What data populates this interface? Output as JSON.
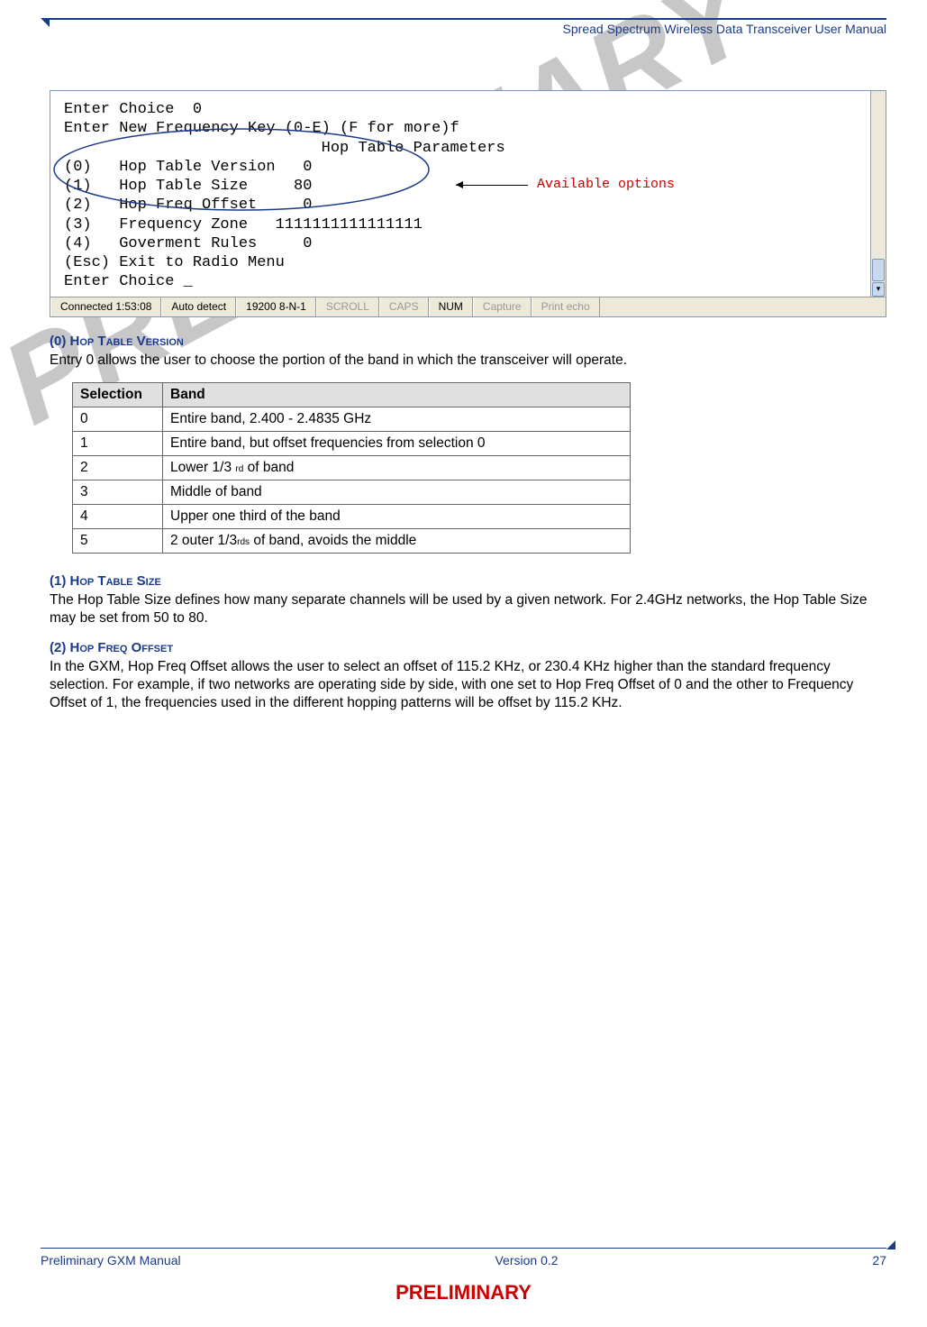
{
  "header": {
    "title": "Spread Spectrum Wireless Data Transceiver User Manual"
  },
  "terminal": {
    "lines": [
      "Enter Choice  0",
      "Enter New Frequency Key (0-E) (F for more)f",
      "                            Hop Table Parameters",
      "(0)   Hop Table Version   0",
      "(1)   Hop Table Size     80",
      "(2)   Hop Freq Offset     0",
      "(3)   Frequency Zone   1111111111111111",
      "(4)   Goverment Rules     0",
      "(Esc) Exit to Radio Menu",
      "Enter Choice _"
    ],
    "status": {
      "connected": "Connected 1:53:08",
      "autodetect": "Auto detect",
      "baud": "19200 8-N-1",
      "scroll": "SCROLL",
      "caps": "CAPS",
      "num": "NUM",
      "capture": "Capture",
      "printecho": "Print echo"
    },
    "annotation": "Available options"
  },
  "sections": [
    {
      "heading_prefix": "(0)",
      "heading_caps": " Hop Table Version",
      "body": "Entry 0 allows the user to choose the portion of the band in which the transceiver will operate."
    },
    {
      "heading_prefix": "(1)",
      "heading_caps": " Hop Table Size",
      "body": "The Hop Table Size defines how many separate channels will be used by a given network.  For 2.4GHz networks, the Hop Table Size may be set from 50 to 80."
    },
    {
      "heading_prefix": "(2)",
      "heading_caps": " Hop Freq Offset",
      "body": "In the GXM, Hop Freq Offset allows the user to select an offset of 115.2 KHz, or 230.4 KHz higher than the standard frequency selection. For example, if two networks are operating side by side, with one set to Hop Freq Offset of 0 and the other to Frequency Offset of 1, the frequencies used in the different hopping patterns will be offset by 115.2 KHz."
    }
  ],
  "table": {
    "headers": [
      "Selection",
      "Band"
    ],
    "rows": [
      [
        "0",
        "Entire band, 2.400 - 2.4835 GHz"
      ],
      [
        "1",
        "Entire band, but offset frequencies from selection 0"
      ],
      [
        "2",
        "Lower 1/3 rd of band"
      ],
      [
        "3",
        "Middle of band"
      ],
      [
        "4",
        "Upper one third of the band"
      ],
      [
        "5",
        "2 outer 1/3rds of band, avoids the middle"
      ]
    ]
  },
  "watermark": "PRELIMINARY",
  "footer": {
    "left": "Preliminary GXM Manual",
    "center": "Version 0.2",
    "right": "27",
    "bottom": "PRELIMINARY"
  }
}
